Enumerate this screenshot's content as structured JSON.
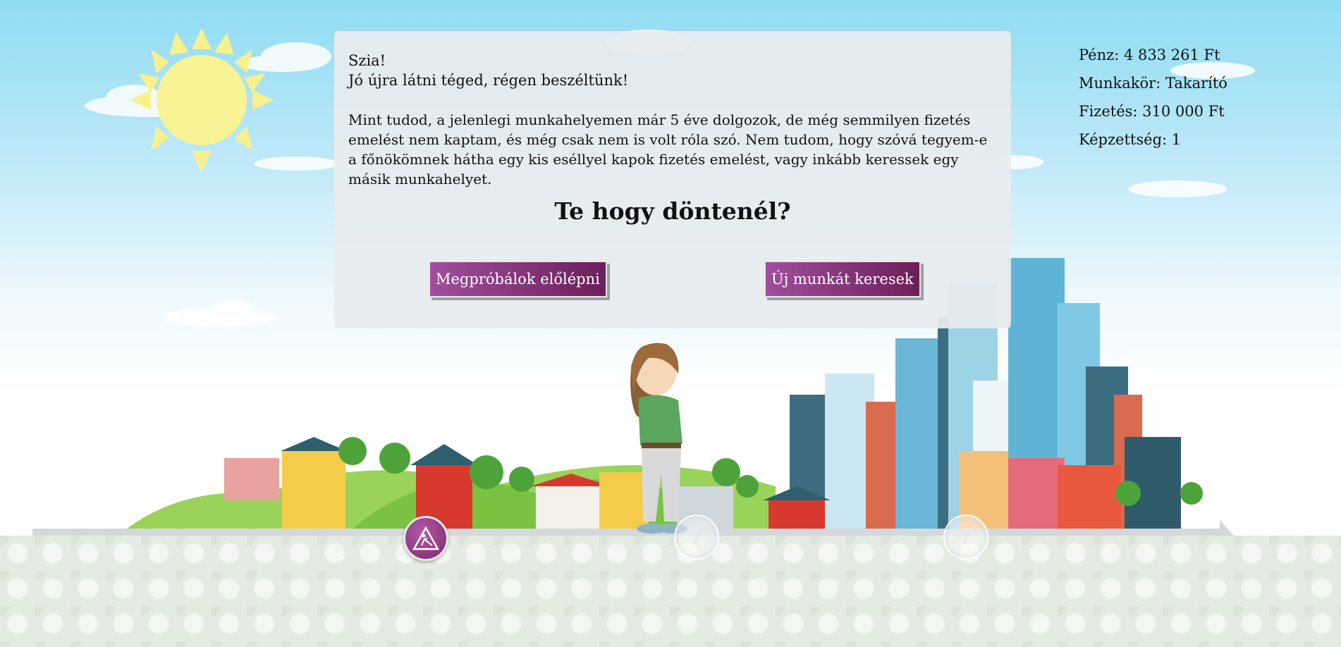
{
  "dialog": {
    "greeting": "Szia!",
    "welcome": "Jó újra látni téged, régen beszéltünk!",
    "story": "Mint tudod, a jelenlegi munkahelyemen már 5 éve dolgozok, de még semmilyen fizetés emelést nem kaptam, és még csak nem is volt róla szó. Nem tudom, hogy szóvá tegyem-e a főnökömnek hátha egy kis eséllyel kapok fizetés emelést, vagy inkább keressek egy másik munkahelyet.",
    "question": "Te hogy döntenél?"
  },
  "choices": {
    "promote": "Megpróbálok előlépni",
    "new_job": "Új munkát keresek"
  },
  "stats": {
    "money": "Pénz: 4 833 261 Ft",
    "job": "Munkakör: Takarító",
    "salary": "Fizetés: 310 000 Ft",
    "education": "Képzettség: 1"
  },
  "timeline": {
    "milestones": [
      {
        "icon": "construction-sign-icon",
        "state": "completed"
      },
      {
        "icon": "question-mark-icon",
        "label": "?",
        "state": "locked"
      },
      {
        "icon": "question-mark-icon",
        "label": "?",
        "state": "locked"
      }
    ]
  },
  "colors": {
    "button_start": "#a04e9d",
    "button_end": "#6b1f58",
    "sky": "#8fdcf3",
    "timeline_bar": "#d4d8dc"
  }
}
